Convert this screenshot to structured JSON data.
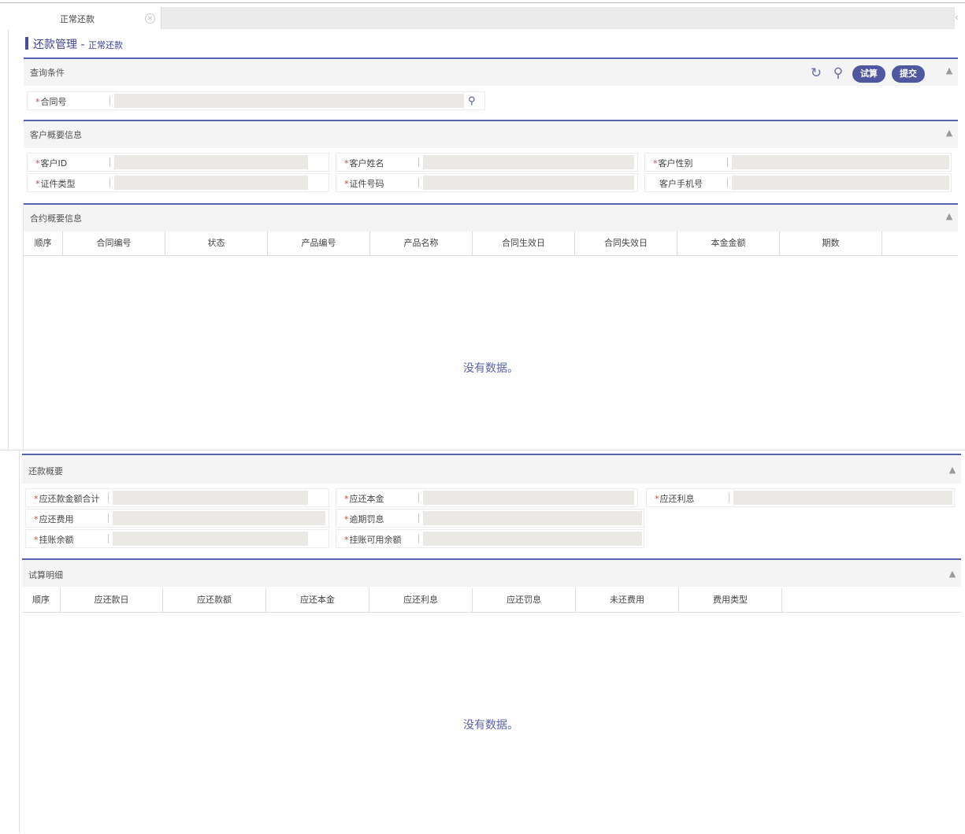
{
  "tab": {
    "label": "正常还款"
  },
  "breadcrumb": {
    "main": "还款管理",
    "sep": " - ",
    "sub": "正常还款"
  },
  "query": {
    "title": "查询条件",
    "buttons": {
      "calc": "试算",
      "submit": "提交"
    },
    "contract_label": "合同号"
  },
  "customer": {
    "title": "客户概要信息",
    "fields": [
      "客户ID",
      "客户姓名",
      "客户性别",
      "证件类型",
      "证件号码",
      "客户手机号"
    ]
  },
  "contract_info": {
    "title": "合约概要信息",
    "columns": [
      "顺序",
      "合同编号",
      "状态",
      "产品编号",
      "产品名称",
      "合同生效日",
      "合同失效日",
      "本金金额",
      "期数"
    ],
    "empty": "没有数据。"
  },
  "repay_summary": {
    "title": "还款概要",
    "fields": [
      "应还款金额合计",
      "应还本金",
      "应还利息",
      "应还费用",
      "逾期罚息",
      "挂账余额",
      "挂账可用余额"
    ]
  },
  "trial_detail": {
    "title": "试算明细",
    "columns": [
      "顺序",
      "应还款日",
      "应还款额",
      "应还本金",
      "应还利息",
      "应还罚息",
      "未还费用",
      "费用类型"
    ],
    "empty": "没有数据。"
  },
  "icons": [
    "refresh-icon",
    "search-icon",
    "collapse-icon",
    "close-icon",
    "chevron-left-icon"
  ],
  "colors": {
    "accent": "#4f57a0",
    "required": "#e03c3c",
    "input_bg": "#ebe9e5"
  }
}
